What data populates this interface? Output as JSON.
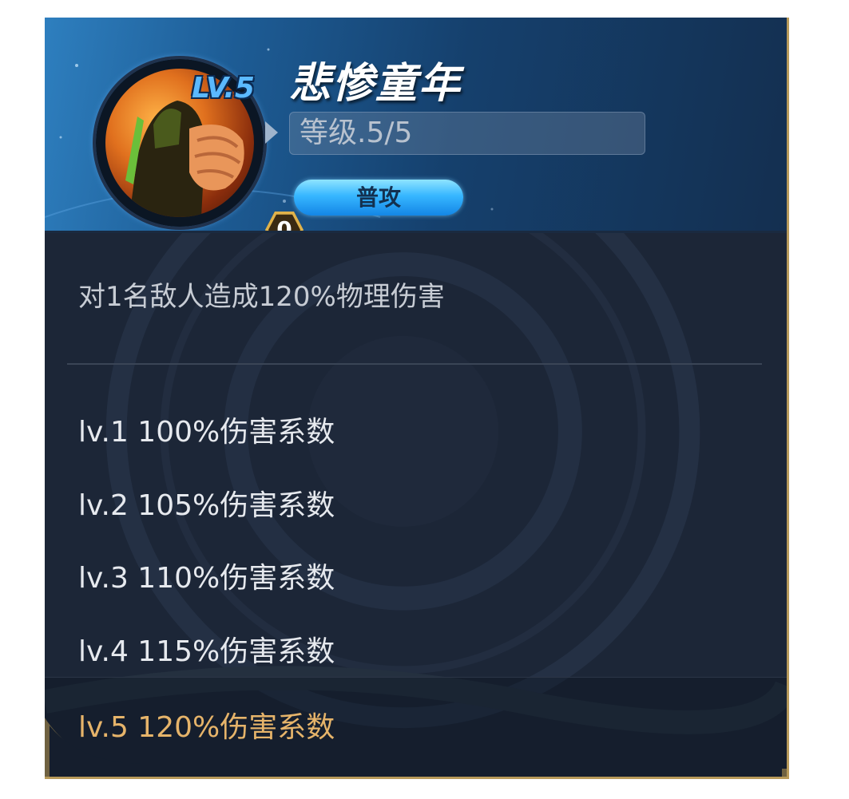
{
  "skill": {
    "name": "悲惨童年",
    "level_badge": "LV.5",
    "level_text": "等级.5/5",
    "type_label": "普攻",
    "rune_count": "0",
    "description": "对1名敌人造成120%物理伤害"
  },
  "level_list": [
    {
      "text": "lv.1 100%伤害系数",
      "active": false
    },
    {
      "text": "lv.2 105%伤害系数",
      "active": false
    },
    {
      "text": "lv.3 110%伤害系数",
      "active": false
    },
    {
      "text": "lv.4 115%伤害系数",
      "active": false
    },
    {
      "text": "lv.5 120%伤害系数",
      "active": true
    }
  ],
  "icons": {
    "portrait": "fist-warrior-portrait-icon",
    "level_arrow": "arrow-right-icon"
  },
  "colors": {
    "panel_bg": "#1c2637",
    "header_blue": "#2e7fbf",
    "pill_blue": "#36b6ff",
    "active_gold": "#e6b46a",
    "border_gold": "#b89a5a"
  }
}
